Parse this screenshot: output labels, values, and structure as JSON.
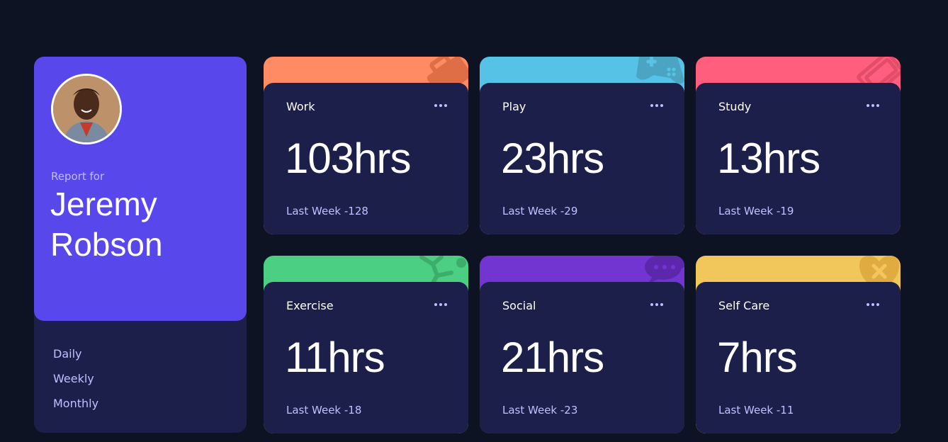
{
  "profile": {
    "report_for": "Report for",
    "name": "Jeremy Robson",
    "periods": [
      "Daily",
      "Weekly",
      "Monthly"
    ],
    "active_period": "Weekly"
  },
  "cards": [
    {
      "title": "Work",
      "hours": "103hrs",
      "previous": "Last Week -128",
      "color": "#ff8b64",
      "icon": "briefcase-icon"
    },
    {
      "title": "Play",
      "hours": "23hrs",
      "previous": "Last Week -29",
      "color": "#55c2e6",
      "icon": "gamepad-icon"
    },
    {
      "title": "Study",
      "hours": "13hrs",
      "previous": "Last Week -19",
      "color": "#ff5e7d",
      "icon": "book-icon"
    },
    {
      "title": "Exercise",
      "hours": "11hrs",
      "previous": "Last Week -18",
      "color": "#4bcf82",
      "icon": "runner-icon"
    },
    {
      "title": "Social",
      "hours": "21hrs",
      "previous": "Last Week -23",
      "color": "#7335d2",
      "icon": "chat-icon"
    },
    {
      "title": "Self Care",
      "hours": "7hrs",
      "previous": "Last Week -11",
      "color": "#f1c75b",
      "icon": "heart-icon"
    }
  ],
  "colors": {
    "page_bg": "#0d1323",
    "card_bg": "#1c1f4a",
    "profile_accent": "#5847eb",
    "muted_text": "#bdc1ff"
  }
}
